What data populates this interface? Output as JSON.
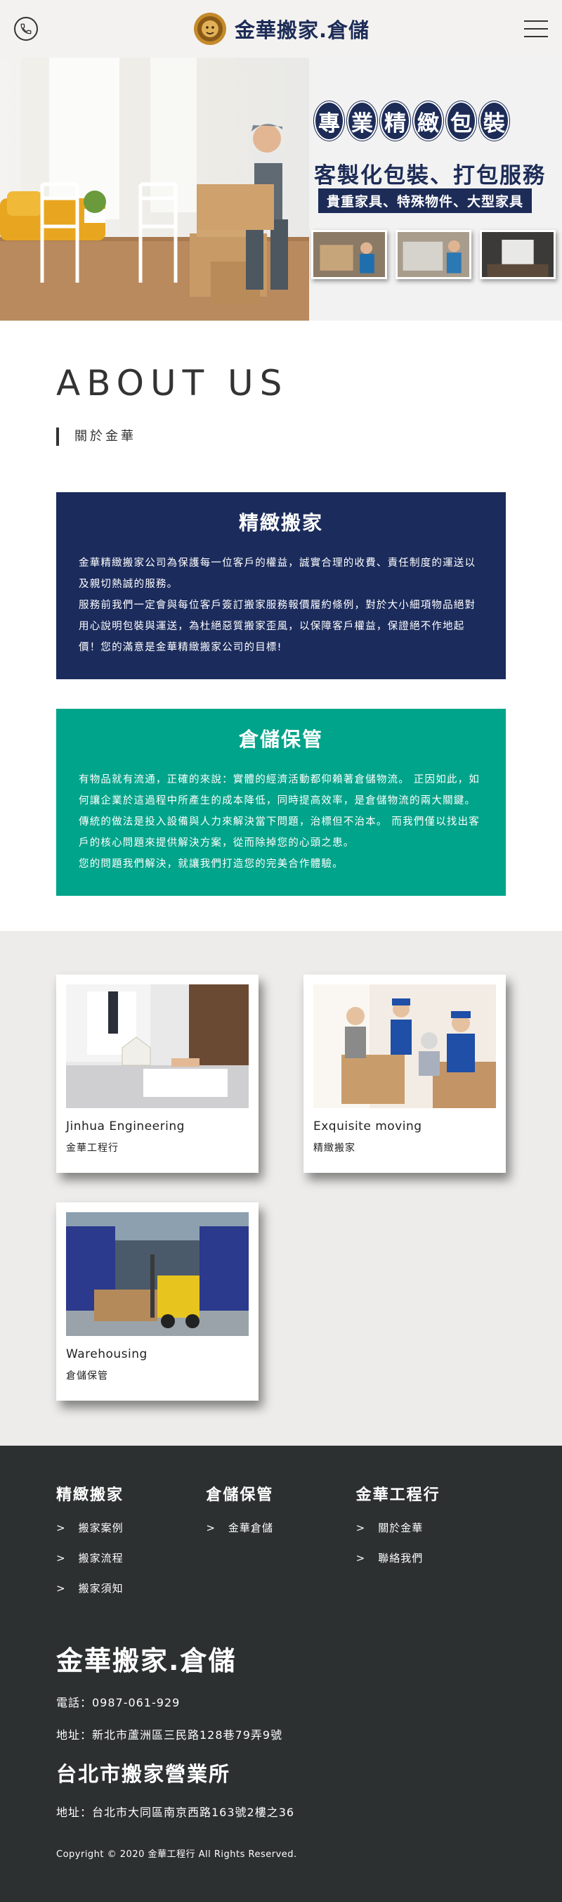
{
  "header": {
    "brand": "金華搬家.倉儲",
    "phone_icon": "phone-icon",
    "menu_icon": "hamburger-menu-icon"
  },
  "hero": {
    "title_chars": [
      "專",
      "業",
      "精",
      "緻",
      "包",
      "裝"
    ],
    "subtitle": "客製化包裝、打包服務",
    "tagline": "貴重家具、特殊物件、大型家具"
  },
  "about": {
    "title": "ABOUT US",
    "subtitle": "關於金華",
    "cards": [
      {
        "heading": "精緻搬家",
        "paragraphs": [
          "金華精緻搬家公司為保護每一位客戶的權益，誠實合理的收費、責任制度的運送以及親切熱誠的服務。",
          "服務前我們一定會與每位客戶簽訂搬家服務報價履約條例，對於大小細項物品絕對用心說明包裝與運送，為杜絕惡質搬家歪風，以保障客戶權益，保證絕不作地起價！您的滿意是金華精緻搬家公司的目標!"
        ]
      },
      {
        "heading": "倉儲保管",
        "paragraphs": [
          "有物品就有流通，正確的來說：實體的經濟活動都仰賴著倉儲物流。 正因如此，如何讓企業於這過程中所產生的成本降低，同時提高效率，是倉儲物流的兩大關鍵。 傳統的做法是投入設備與人力來解決當下問題，治標但不治本。 而我們僅以找出客戶的核心問題來提供解決方案，從而除掉您的心頭之患。",
          "您的問題我們解決，就讓我們打造您的完美合作體驗。"
        ]
      }
    ]
  },
  "services": [
    {
      "en": "Jinhua Engineering",
      "zh": "金華工程行"
    },
    {
      "en": "Exquisite moving",
      "zh": "精緻搬家"
    },
    {
      "en": "Warehousing",
      "zh": "倉儲保管"
    }
  ],
  "footer": {
    "columns": [
      {
        "heading": "精緻搬家",
        "links": [
          "搬家案例",
          "搬家流程",
          "搬家須知"
        ]
      },
      {
        "heading": "倉儲保管",
        "links": [
          "金華倉儲"
        ]
      },
      {
        "heading": "金華工程行",
        "links": [
          "關於金華",
          "聯絡我們"
        ]
      }
    ],
    "arrow": ">",
    "brand": "金華搬家.倉儲",
    "phone": "電話：0987-061-929",
    "address": "地址：新北市蘆洲區三民路128巷79弄9號",
    "branch_title": "台北市搬家營業所",
    "branch_address": "地址：台北市大同區南京西路163號2樓之36",
    "copyright": "Copyright © 2020 金華工程行 All Rights Reserved."
  },
  "colors": {
    "navy": "#1b2b5c",
    "teal": "#00a48a",
    "footer_bg": "#2c3030",
    "services_bg": "#edeceb"
  }
}
